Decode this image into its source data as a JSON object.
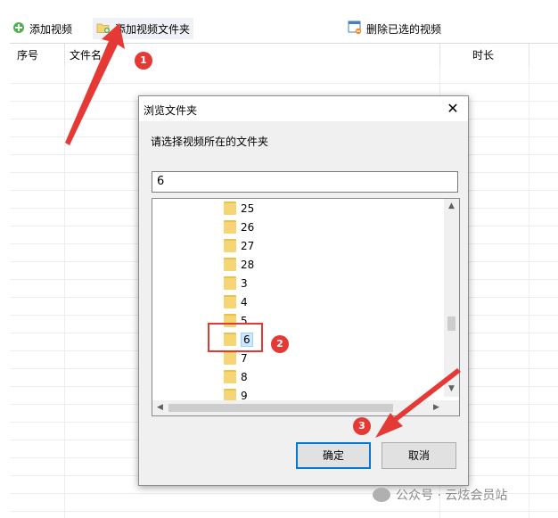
{
  "toolbar": {
    "add_video": "添加视频",
    "add_folder": "添加视频文件夹",
    "delete_selected": "删除已选的视频"
  },
  "table": {
    "headers": [
      "序号",
      "文件名",
      "时长"
    ]
  },
  "dialog": {
    "title": "浏览文件夹",
    "close": "✕",
    "prompt": "请选择视频所在的文件夹",
    "path_value": "6",
    "folders": [
      "25",
      "26",
      "27",
      "28",
      "3",
      "4",
      "5",
      "6",
      "7",
      "8",
      "9"
    ],
    "selected_folder": "6",
    "ok_label": "确定",
    "cancel_label": "取消"
  },
  "annotations": {
    "step1": "1",
    "step2": "2",
    "step3": "3",
    "color": "#e53935"
  },
  "watermark": {
    "text": "公众号 · 云炫会员站"
  },
  "icons": {
    "add_video": "plus-circle-icon",
    "add_folder": "folder-add-icon",
    "delete": "delete-window-icon",
    "folder": "folder-icon"
  }
}
